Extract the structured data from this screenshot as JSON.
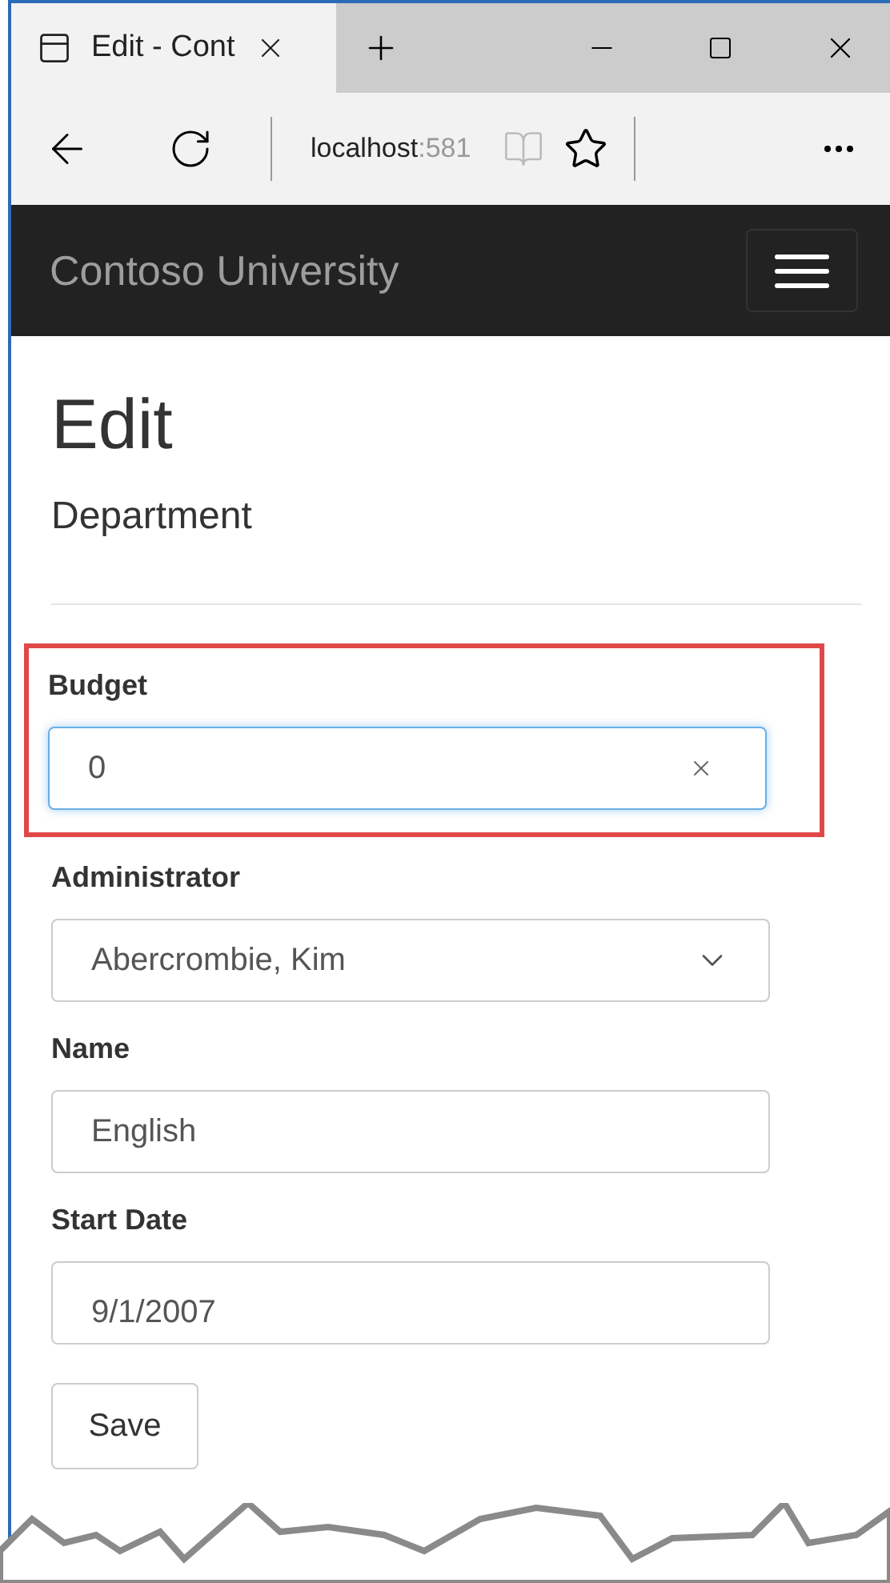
{
  "browser": {
    "tab_title": "Edit - Cont",
    "address_host": "localhost",
    "address_port": ":581"
  },
  "navbar": {
    "brand": "Contoso University"
  },
  "page": {
    "title": "Edit",
    "subtitle": "Department"
  },
  "fields": [
    {
      "label": "Budget",
      "kind": "text",
      "value": "0",
      "focused": true,
      "highlighted": true
    },
    {
      "label": "Administrator",
      "kind": "select",
      "value": "Abercrombie, Kim",
      "focused": false,
      "highlighted": false
    },
    {
      "label": "Name",
      "kind": "text",
      "value": "English",
      "focused": false,
      "highlighted": false
    },
    {
      "label": "Start Date",
      "kind": "date",
      "value": "9/1/2007",
      "focused": false,
      "highlighted": false
    }
  ],
  "save_button": "Save"
}
